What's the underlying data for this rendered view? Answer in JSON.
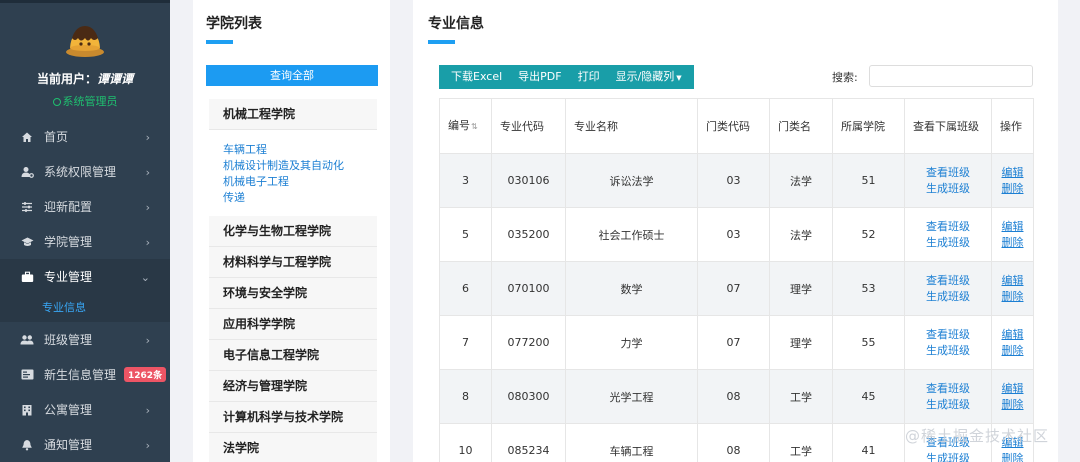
{
  "sidebar": {
    "user_prefix": "当前用户：",
    "user_name": "谭谭谭",
    "role": "系统管理员",
    "menu": [
      {
        "label": "首页",
        "icon": "home-icon"
      },
      {
        "label": "系统权限管理",
        "icon": "user-settings-icon"
      },
      {
        "label": "迎新配置",
        "icon": "sliders-icon"
      },
      {
        "label": "学院管理",
        "icon": "graduation-cap-icon"
      },
      {
        "label": "专业管理",
        "icon": "briefcase-icon"
      },
      {
        "label": "班级管理",
        "icon": "users-icon"
      },
      {
        "label": "新生信息管理",
        "icon": "id-card-icon",
        "badge": "1262条"
      },
      {
        "label": "公寓管理",
        "icon": "building-icon"
      },
      {
        "label": "通知管理",
        "icon": "bell-icon"
      }
    ],
    "active_sub": "专业信息"
  },
  "college_panel": {
    "title": "学院列表",
    "query_all": "查询全部",
    "colleges": [
      "机械工程学院",
      "化学与生物工程学院",
      "材料科学与工程学院",
      "环境与安全学院",
      "应用科学学院",
      "电子信息工程学院",
      "经济与管理学院",
      "计算机科学与技术学院",
      "法学院"
    ],
    "expanded_majors": [
      "车辆工程",
      "机械设计制造及其自动化",
      "机械电子工程",
      "传递"
    ]
  },
  "major_panel": {
    "title": "专业信息",
    "toolbar": {
      "excel": "下载Excel",
      "pdf": "导出PDF",
      "print": "打印",
      "toggle_cols": "显示/隐藏列"
    },
    "search_label": "搜索:",
    "search_value": "",
    "columns": [
      "编号",
      "专业代码",
      "专业名称",
      "门类代码",
      "门类名",
      "所属学院",
      "查看下属班级",
      "操作"
    ],
    "actions": {
      "view_class": "查看班级",
      "gen_class": "生成班级",
      "edit": "编辑",
      "delete": "删除"
    },
    "rows": [
      {
        "id": "3",
        "code": "030106",
        "name": "诉讼法学",
        "cat_code": "03",
        "cat_name": "法学",
        "college": "51"
      },
      {
        "id": "5",
        "code": "035200",
        "name": "社会工作硕士",
        "cat_code": "03",
        "cat_name": "法学",
        "college": "52"
      },
      {
        "id": "6",
        "code": "070100",
        "name": "数学",
        "cat_code": "07",
        "cat_name": "理学",
        "college": "53"
      },
      {
        "id": "7",
        "code": "077200",
        "name": "力学",
        "cat_code": "07",
        "cat_name": "理学",
        "college": "55"
      },
      {
        "id": "8",
        "code": "080300",
        "name": "光学工程",
        "cat_code": "08",
        "cat_name": "工学",
        "college": "45"
      },
      {
        "id": "10",
        "code": "085234",
        "name": "车辆工程",
        "cat_code": "08",
        "cat_name": "工学",
        "college": "41"
      }
    ]
  },
  "watermark": "@稀土掘金技术社区",
  "colors": {
    "sidebar_bg": "#2f4050",
    "accent_blue": "#1c9bf2",
    "toolbar_teal": "#199ea8",
    "badge_red": "#ed5565",
    "role_green": "#1fbf6f"
  }
}
